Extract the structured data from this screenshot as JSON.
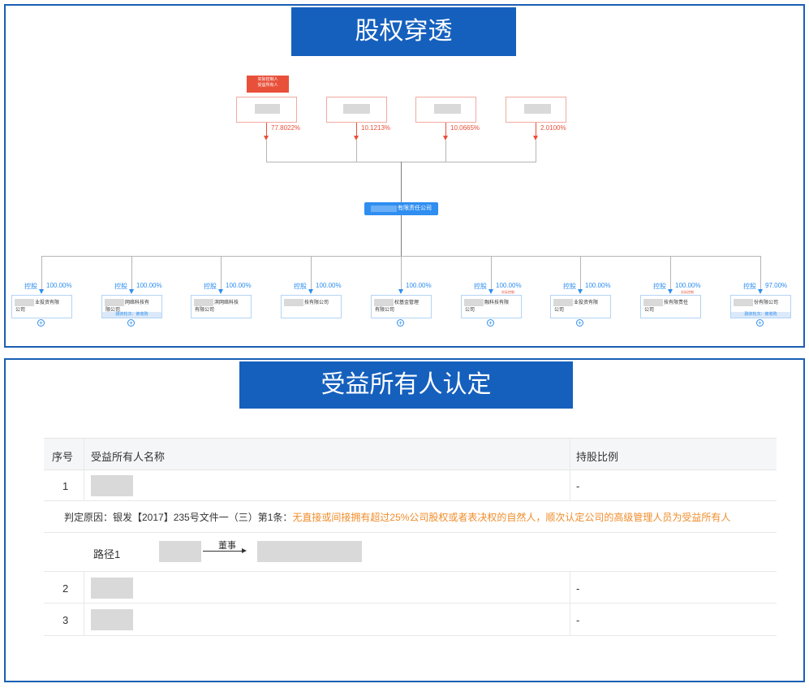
{
  "equity": {
    "title": "股权穿透",
    "tag_lines": [
      "实际控制人",
      "受益所有人"
    ],
    "shareholders": [
      {
        "pct": "77.8022%"
      },
      {
        "pct": "10.1213%"
      },
      {
        "pct": "10.0665%"
      },
      {
        "pct": "2.0100%"
      }
    ],
    "center_company": "有限责任公司",
    "subsidiaries": [
      {
        "ctl": "控股",
        "pct": "100.00%",
        "line1": "业投资有限",
        "line2": "公司",
        "foot": "",
        "red": "",
        "expand": "+"
      },
      {
        "ctl": "控股",
        "pct": "100.00%",
        "line1": "网络科技有",
        "line2": "限公司",
        "foot": "融资轮次：被收购",
        "red": "",
        "expand": "+"
      },
      {
        "ctl": "控股",
        "pct": "100.00%",
        "line1": "滨网络科技",
        "line2": "有限公司",
        "foot": "",
        "red": "",
        "expand": ""
      },
      {
        "ctl": "控股",
        "pct": "100.00%",
        "line1": "技有限公司",
        "line2": "",
        "foot": "",
        "red": "",
        "expand": ""
      },
      {
        "ctl": "",
        "pct": "100.00%",
        "line1": "权基金管理",
        "line2": "有限公司",
        "foot": "",
        "red": "",
        "expand": "+"
      },
      {
        "ctl": "控股",
        "pct": "100.00%",
        "line1": "融科技有限",
        "line2": "公司",
        "foot": "",
        "red": "实际控制",
        "expand": "+"
      },
      {
        "ctl": "控股",
        "pct": "100.00%",
        "line1": "业投资有限",
        "line2": "公司",
        "foot": "",
        "red": "",
        "expand": "+"
      },
      {
        "ctl": "控股",
        "pct": "100.00%",
        "line1": "技有限责任",
        "line2": "公司",
        "foot": "",
        "red": "实际控制",
        "expand": ""
      },
      {
        "ctl": "控股",
        "pct": "97.00%",
        "line1": "份有限公司",
        "line2": "",
        "foot": "融资轮次：被收购",
        "red": "",
        "expand": "+"
      }
    ]
  },
  "beneficial": {
    "title": "受益所有人认定",
    "columns": [
      "序号",
      "受益所有人名称",
      "持股比例"
    ],
    "rows": [
      {
        "no": "1",
        "ratio": "-"
      },
      {
        "no": "2",
        "ratio": "-"
      },
      {
        "no": "3",
        "ratio": "-"
      }
    ],
    "reason_label": "判定原因：银发【2017】235号文件一（三）第1条：",
    "reason_text": "无直接或间接拥有超过25%公司股权或者表决权的自然人，顺次认定公司的高级管理人员为受益所有人",
    "path_label": "路径1",
    "path_relation": "董事"
  },
  "colors": {
    "banner": "#1560bd",
    "red": "#e8503a",
    "blue": "#2f8ef0",
    "orange": "#f08c2a"
  }
}
